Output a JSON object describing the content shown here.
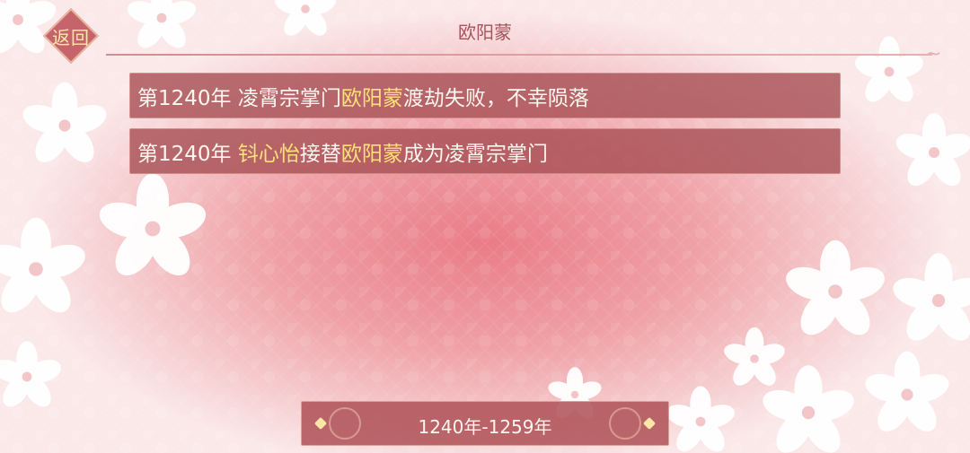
{
  "header": {
    "back_label": "返回",
    "title": "欧阳蒙"
  },
  "events": [
    {
      "parts": [
        {
          "text": "第1240年 凌霄宗掌门",
          "highlight": false
        },
        {
          "text": "欧阳蒙",
          "highlight": true
        },
        {
          "text": "渡劫失败，不幸陨落",
          "highlight": false
        }
      ]
    },
    {
      "parts": [
        {
          "text": "第1240年 ",
          "highlight": false
        },
        {
          "text": "钭心怡",
          "highlight": true
        },
        {
          "text": "接替",
          "highlight": false
        },
        {
          "text": "欧阳蒙",
          "highlight": true
        },
        {
          "text": "成为凌霄宗掌门",
          "highlight": false
        }
      ]
    }
  ],
  "period": {
    "label": "1240年-1259年"
  },
  "colors": {
    "highlight": "#ffe07a",
    "row_bg": "#a85056",
    "back_text": "#ffe7a8"
  }
}
